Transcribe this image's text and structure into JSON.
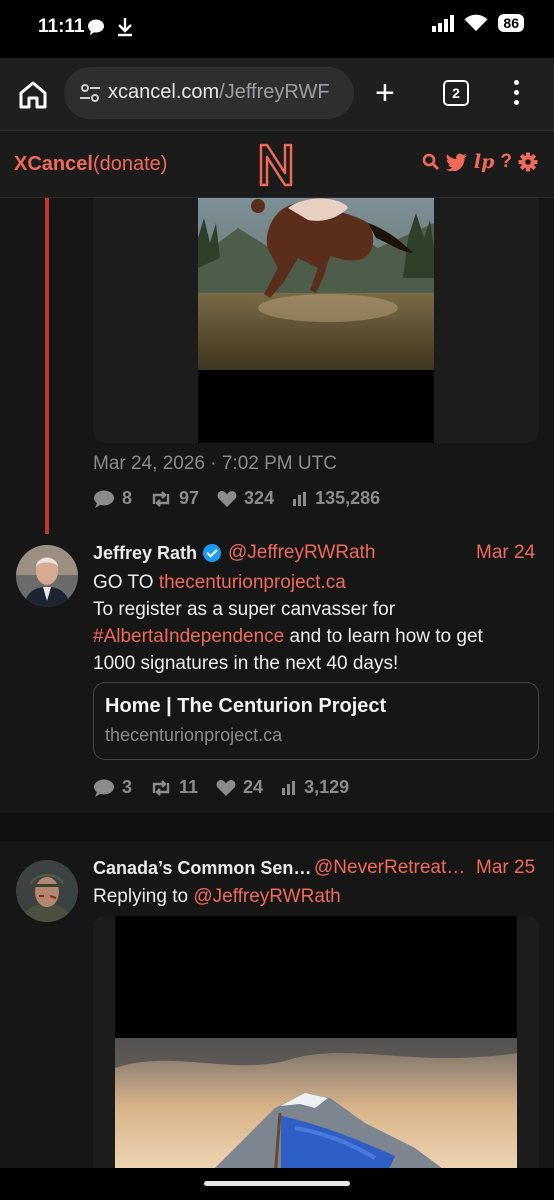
{
  "status_bar": {
    "time": "11:11",
    "battery": "86"
  },
  "browser": {
    "url_domain": "xcancel.com",
    "url_path": "/JeffreyRWF",
    "tab_count": "2"
  },
  "site": {
    "brand": "XCancel",
    "donate": "(donate)",
    "rss_label": "?"
  },
  "tweet1": {
    "date": "Mar 24, 2026 · 7:02 PM UTC",
    "replies": "8",
    "retweets": "97",
    "likes": "324",
    "views": "135,286"
  },
  "tweet2": {
    "name": "Jeffrey Rath",
    "handle": "@JeffreyRWRath",
    "date": "Mar 24",
    "line1_prefix": "GO TO ",
    "line1_link": "thecenturionproject.ca",
    "line2": "To register as a super canvasser for",
    "hashtag": "#AlbertaIndependence",
    "line3_rest": " and to learn how to get",
    "line4": "1000 signatures in the next 40 days!",
    "card_title": "Home | The Centurion Project",
    "card_domain": "thecenturionproject.ca",
    "replies": "3",
    "retweets": "11",
    "likes": "24",
    "views": "3,129"
  },
  "tweet3": {
    "name": "Canada’s Common Sen…",
    "handle": "@NeverRetreat…",
    "date": "Mar 25",
    "replying_prefix": "Replying to ",
    "replying_handle": "@JeffreyRWRath"
  }
}
